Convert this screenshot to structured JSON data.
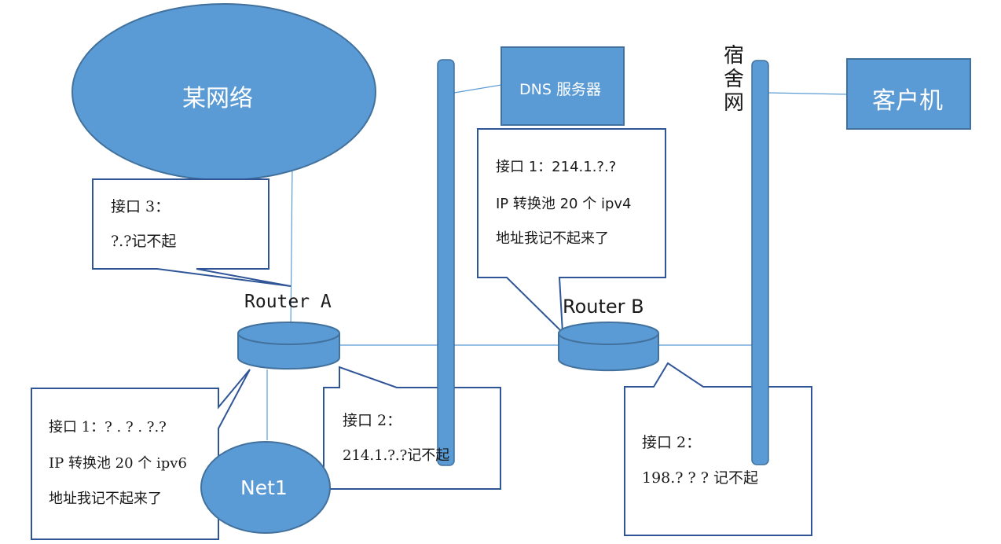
{
  "cloud": {
    "label": "某网络"
  },
  "dns": {
    "label": "DNS 服务器"
  },
  "client": {
    "label": "客户机"
  },
  "dorm_network": {
    "label": "宿舍网"
  },
  "router_a": {
    "label": "Router A"
  },
  "router_b": {
    "label": "Router B"
  },
  "net1": {
    "label": "Net1"
  },
  "callouts": {
    "a_interface3": {
      "line1": "接口 3：",
      "line2": "?.?记不起"
    },
    "a_interface1": {
      "line1": "接口 1：? . ? . ?.?",
      "line2": "IP 转换池 20 个 ipv6",
      "line3": "地址我记不起来了"
    },
    "a_interface2": {
      "line1": "接口 2：",
      "line2": "214.1.?.?记不起"
    },
    "b_interface1": {
      "line1": "接口 1：214.1.?.?",
      "line2": "IP 转换池 20 个 ipv4",
      "line3": "地址我记不起来了"
    },
    "b_interface2": {
      "line1": "接口 2：",
      "line2": "198.? ? ? 记不起"
    }
  },
  "colors": {
    "fill": "#5b9bd5",
    "stroke": "#41719c",
    "link": "#5b9bd5",
    "callout_border": "#2f5597"
  }
}
